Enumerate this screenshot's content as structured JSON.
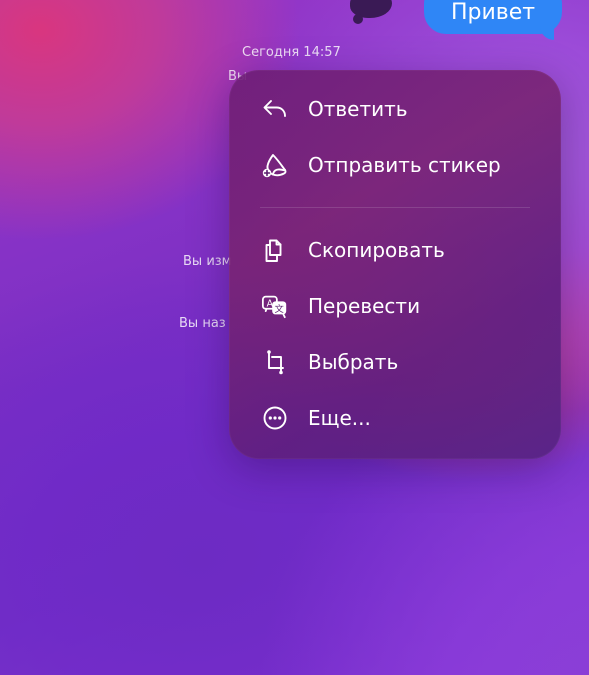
{
  "chat": {
    "outgoing_message": "Привет",
    "date_separator": "Сегодня 14:57",
    "system_messages": [
      "Вы",
      "Вы изм",
      "Вы наз"
    ]
  },
  "context_menu": {
    "items": [
      {
        "label": "Ответить",
        "icon": "reply-icon"
      },
      {
        "label": "Отправить стикер",
        "icon": "sticker-add-icon"
      },
      {
        "label": "Скопировать",
        "icon": "copy-icon"
      },
      {
        "label": "Перевести",
        "icon": "translate-icon"
      },
      {
        "label": "Выбрать",
        "icon": "select-crop-icon"
      },
      {
        "label": "Еще...",
        "icon": "more-ellipsis-icon"
      }
    ]
  },
  "colors": {
    "bubble": "#2f86f6",
    "menu_text": "#ffffff"
  }
}
